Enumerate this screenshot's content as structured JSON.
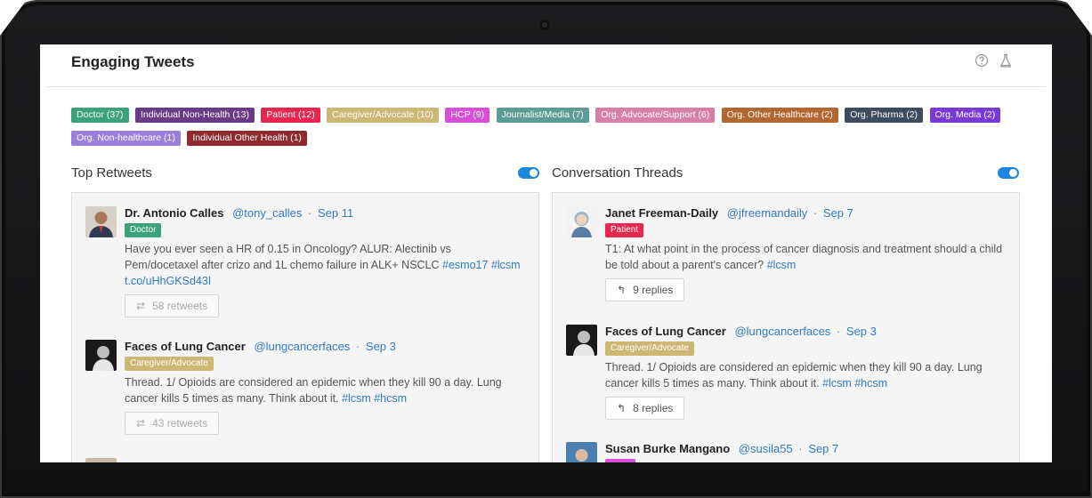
{
  "card": {
    "title": "Engaging Tweets"
  },
  "icons": {
    "help": "help-circle-icon",
    "flask": "flask-icon"
  },
  "tags": [
    {
      "label": "Doctor (37)",
      "color": "#3aa37c"
    },
    {
      "label": "Individual Non-Health (13)",
      "color": "#6b3a86"
    },
    {
      "label": "Patient (12)",
      "color": "#e8264f"
    },
    {
      "label": "Caregiver/Advocate (10)",
      "color": "#cdb774"
    },
    {
      "label": "HCP (9)",
      "color": "#d94ed8"
    },
    {
      "label": "Journalist/Media (7)",
      "color": "#5b9c96"
    },
    {
      "label": "Org. Advocate/Support (6)",
      "color": "#d77fa6"
    },
    {
      "label": "Org. Other Healthcare (2)",
      "color": "#b3662f"
    },
    {
      "label": "Org. Pharma (2)",
      "color": "#3d4b5e"
    },
    {
      "label": "Org. Media (2)",
      "color": "#7a38d6"
    },
    {
      "label": "Org. Non-healthcare (1)",
      "color": "#9a7fdc"
    },
    {
      "label": "Individual Other Health (1)",
      "color": "#8f2a2f"
    }
  ],
  "top_retweets": {
    "title": "Top Retweets",
    "tweets": [
      {
        "name": "Dr. Antonio Calles",
        "handle": "@tony_calles",
        "date": "Sep 11",
        "badge": "Doctor",
        "badge_color": "#3aa37c",
        "text": "Have you ever seen a HR of 0.15 in Oncology? ALUR: Alectinib vs Pem/docetaxel after crizo and 1L chemo failure in ALK+ NSCLC",
        "hashtags": [
          "#esmo17",
          "#lcsm"
        ],
        "link": "t.co/uHhGKSd43I",
        "action": "58 retweets"
      },
      {
        "name": "Faces of Lung Cancer",
        "handle": "@lungcancerfaces",
        "date": "Sep 3",
        "badge": "Caregiver/Advocate",
        "badge_color": "#cdb774",
        "text": "Thread. 1/ Opioids are considered an epidemic when they kill 90 a day. Lung cancer kills 5 times as many. Think about it.",
        "hashtags": [
          "#lcsm",
          "#hcsm"
        ],
        "action": "43 retweets"
      }
    ]
  },
  "conversation_threads": {
    "title": "Conversation Threads",
    "tweets": [
      {
        "name": "Janet Freeman-Daily",
        "handle": "@jfreemandaily",
        "date": "Sep 7",
        "badge": "Patient",
        "badge_color": "#e8264f",
        "text": "T1: At what point in the process of cancer diagnosis and treatment should a child be told about a parent's cancer?",
        "hashtags": [
          "#lcsm"
        ],
        "action": "9 replies"
      },
      {
        "name": "Faces of Lung Cancer",
        "handle": "@lungcancerfaces",
        "date": "Sep 3",
        "badge": "Caregiver/Advocate",
        "badge_color": "#cdb774",
        "text": "Thread. 1/ Opioids are considered an epidemic when they kill 90 a day. Lung cancer kills 5 times as many. Think about it.",
        "hashtags": [
          "#lcsm",
          "#hcsm"
        ],
        "action": "8 replies"
      },
      {
        "name": "Susan Burke Mangano",
        "handle": "@susila55",
        "date": "Sep 7"
      }
    ]
  },
  "separator": "·"
}
